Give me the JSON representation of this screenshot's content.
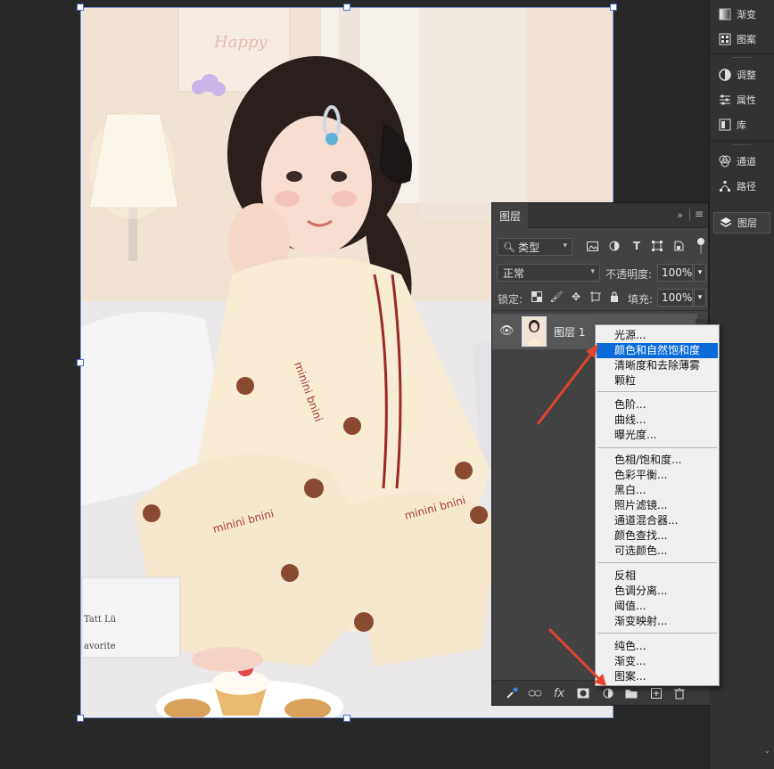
{
  "dock": {
    "items": [
      {
        "label": "渐变",
        "icon": "gradient-icon"
      },
      {
        "label": "图案",
        "icon": "pattern-icon"
      },
      {
        "label": "调整",
        "icon": "adjustments-icon"
      },
      {
        "label": "属性",
        "icon": "properties-icon"
      },
      {
        "label": "库",
        "icon": "libraries-icon"
      },
      {
        "label": "通道",
        "icon": "channels-icon"
      },
      {
        "label": "路径",
        "icon": "paths-icon"
      },
      {
        "label": "图层",
        "icon": "layers-icon"
      }
    ]
  },
  "layers_panel": {
    "tab": "图层",
    "filter_kind": "类型",
    "blend_mode": "正常",
    "opacity_label": "不透明度:",
    "opacity_value": "100%",
    "lock_label": "锁定:",
    "fill_label": "填充:",
    "fill_value": "100%",
    "layer_name": "图层 1",
    "footer_fx": "fx"
  },
  "context_menu": {
    "groups": [
      [
        "光源...",
        "颜色和自然饱和度",
        "清晰度和去除薄雾",
        "颗粒"
      ],
      [
        "色阶...",
        "曲线...",
        "曝光度..."
      ],
      [
        "色相/饱和度...",
        "色彩平衡...",
        "黑白...",
        "照片滤镜...",
        "通道混合器...",
        "颜色查找...",
        "可选颜色..."
      ],
      [
        "反相",
        "色调分离...",
        "阈值...",
        "渐变映射..."
      ],
      [
        "纯色...",
        "渐变...",
        "图案..."
      ]
    ],
    "highlighted": "颜色和自然饱和度"
  },
  "photo": {
    "wall_sign": "Happy",
    "pajama_brand": "minini bnini",
    "card_text_1": "Tatt Lü",
    "card_text_2": "avorite"
  },
  "colors": {
    "accent": "#0a6bd8",
    "arrow": "#e0452c",
    "panel_bg": "#424242"
  }
}
